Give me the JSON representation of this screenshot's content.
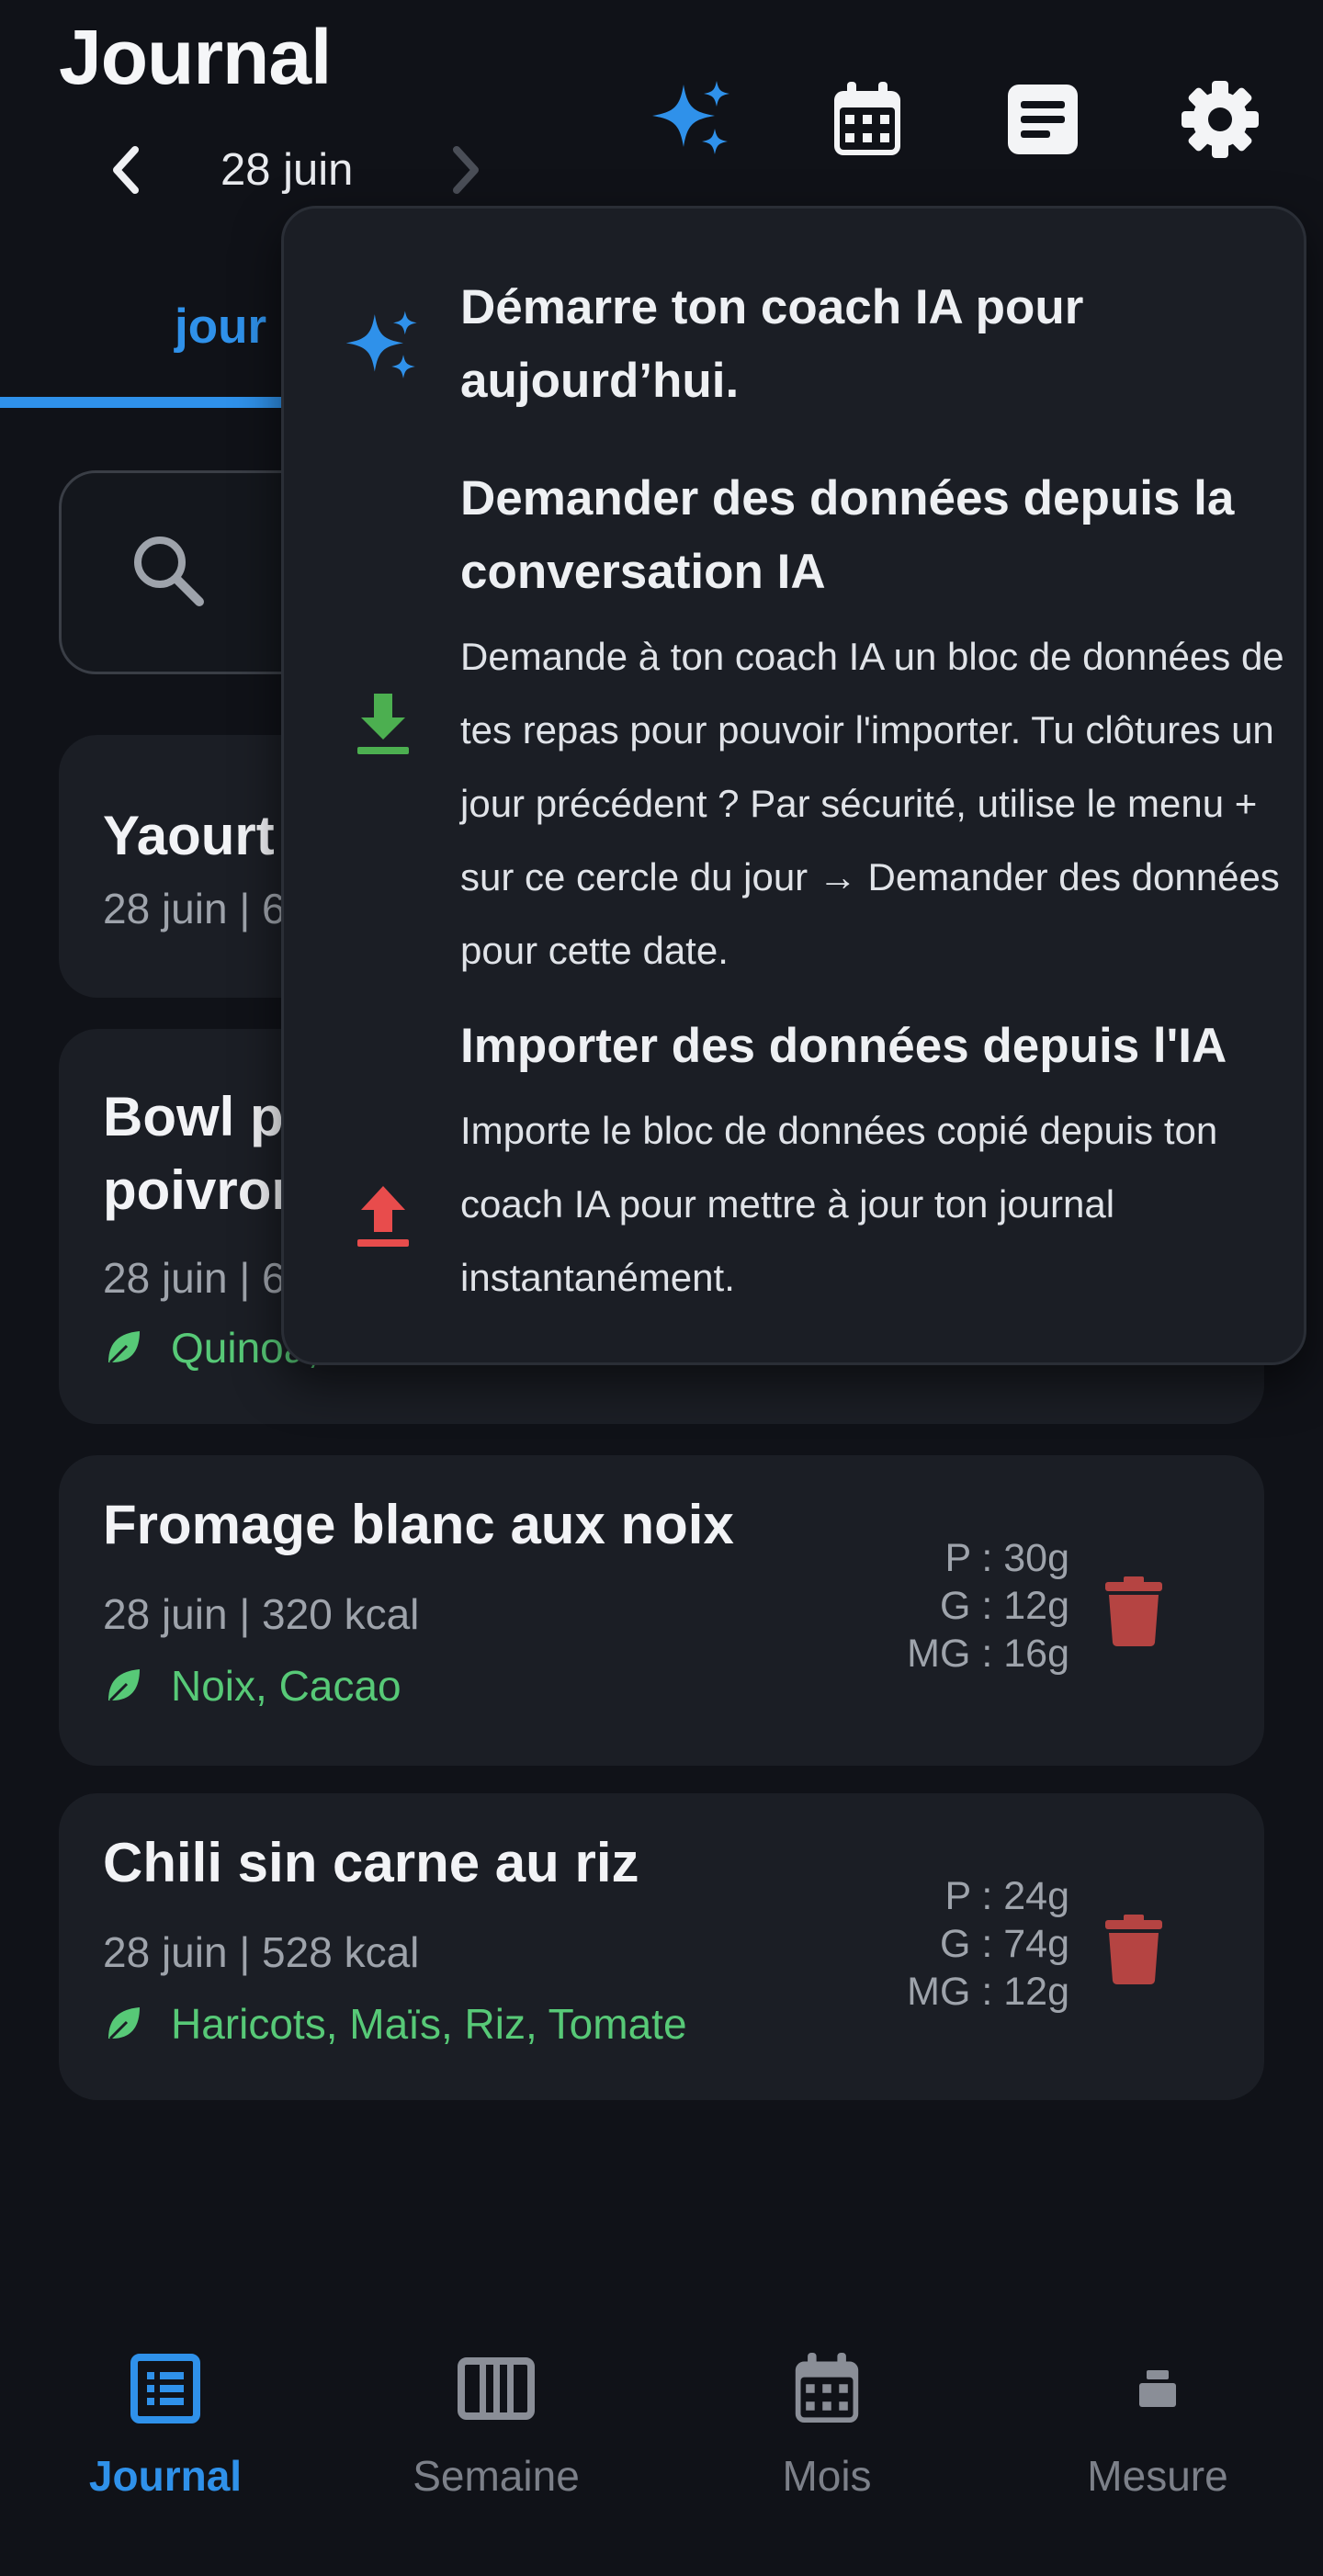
{
  "header": {
    "title": "Journal",
    "date": "28 juin"
  },
  "tabs": {
    "day": "jour"
  },
  "popup": {
    "sections": [
      {
        "heading": "Démarre ton coach IA pour aujourd’hui.",
        "icon": "sparkles-icon"
      },
      {
        "heading": "Demander des données depuis la conversation IA",
        "description": "Demande à ton coach IA un bloc de données de tes repas pour pouvoir l'importer. Tu clôtures un jour précédent ? Par sécurité, utilise le menu + sur ce cercle du jour → Demander des données pour cette date.",
        "icon": "download-icon"
      },
      {
        "heading": "Importer des données depuis l'IA",
        "description": "Importe le bloc de données copié depuis ton coach IA pour mettre à jour ton journal instantanément.",
        "icon": "upload-icon"
      }
    ]
  },
  "meals": [
    {
      "title": "Yaourt",
      "meta": "28 juin | 6"
    },
    {
      "title": "Bowl p",
      "title2": "poivron",
      "meta": "28 juin | 6",
      "ingredients": "Quinoa,"
    },
    {
      "title": "Fromage blanc aux noix",
      "meta": "28 juin | 320 kcal",
      "ingredients": "Noix, Cacao",
      "p": "P : 30g",
      "g": "G : 12g",
      "mg": "MG : 16g"
    },
    {
      "title": "Chili sin carne au riz",
      "meta": "28 juin | 528 kcal",
      "ingredients": "Haricots, Maïs, Riz, Tomate",
      "p": "P : 24g",
      "g": "G : 74g",
      "mg": "MG : 12g"
    }
  ],
  "nav": [
    {
      "label": "Journal",
      "icon": "journal-list-icon",
      "active": true
    },
    {
      "label": "Semaine",
      "icon": "week-columns-icon",
      "active": false
    },
    {
      "label": "Mois",
      "icon": "calendar-month-icon",
      "active": false
    },
    {
      "label": "Mesure",
      "icon": "scale-icon",
      "active": false
    }
  ],
  "colors": {
    "accent": "#2f91ea",
    "ingredient_green": "#57c977",
    "delete_red": "#b54442",
    "download_green": "#4caf50",
    "upload_red": "#e84c4c"
  }
}
